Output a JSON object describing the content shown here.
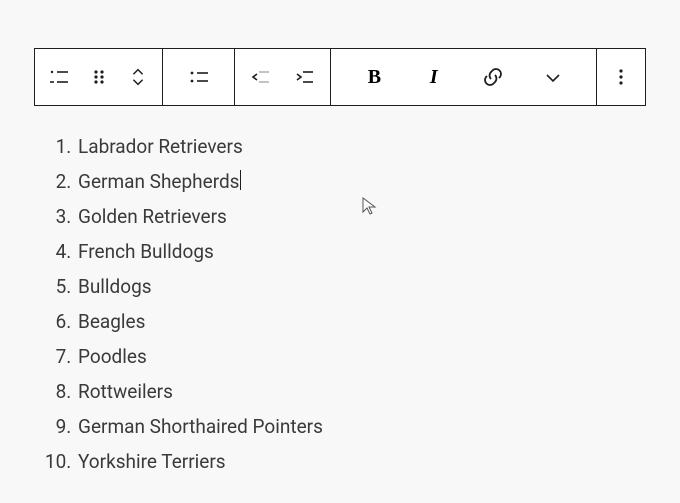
{
  "toolbar": {
    "block_type": "ordered-list",
    "drag_handle": "drag",
    "mover": "move-up-down",
    "list_style": "unordered-bullet",
    "outdent": "outdent",
    "indent": "indent",
    "bold": "B",
    "italic": "I",
    "link": "link",
    "more_rich": "more-richtext",
    "options": "options"
  },
  "list": {
    "items": [
      "Labrador Retrievers",
      "German Shepherds",
      "Golden Retrievers",
      "French Bulldogs",
      "Bulldogs",
      "Beagles",
      "Poodles",
      "Rottweilers",
      "German Shorthaired Pointers",
      "Yorkshire Terriers"
    ],
    "caret_item_index": 1
  }
}
